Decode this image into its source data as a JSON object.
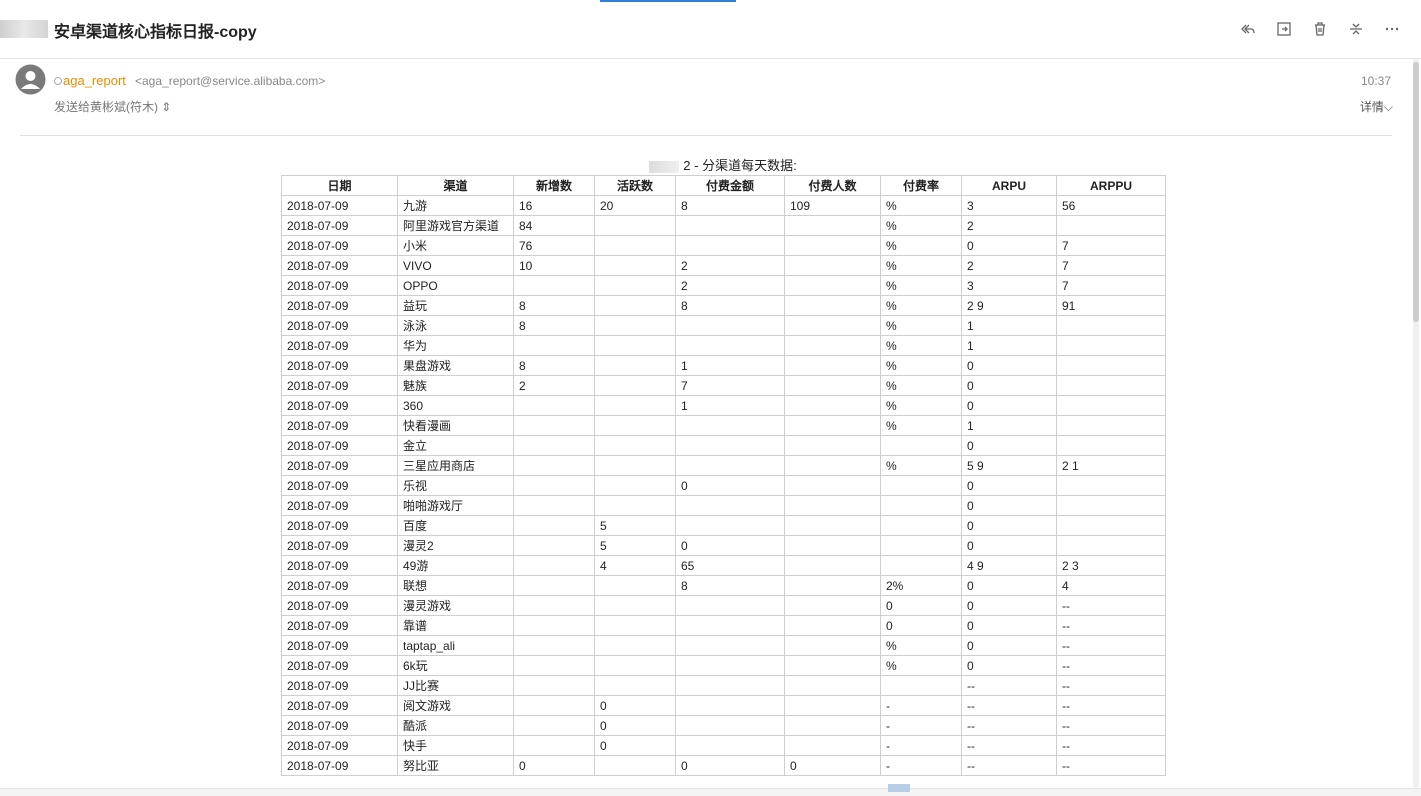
{
  "subject": "安卓渠道核心指标日报-copy",
  "toolbar": {
    "reply_all": "reply-all",
    "forward": "forward",
    "delete": "delete",
    "fold": "collapse",
    "more": "more"
  },
  "sender": {
    "name": "aga_report",
    "email": "<aga_report@service.alibaba.com>",
    "recipients": "发送给黄彬斌(符木)",
    "time": "10:37",
    "details": "详情"
  },
  "report": {
    "title": "2 - 分渠道每天数据:",
    "headers": [
      "日期",
      "渠道",
      "新增数",
      "活跃数",
      "付费金额",
      "付费人数",
      "付费率",
      "ARPU",
      "ARPPU"
    ],
    "rows": [
      [
        "2018-07-09",
        "九游",
        "16",
        "20",
        "8",
        "109",
        "%",
        "3",
        "56"
      ],
      [
        "2018-07-09",
        "阿里游戏官方渠道",
        "84",
        "",
        "",
        "",
        "%",
        "2",
        ""
      ],
      [
        "2018-07-09",
        "小米",
        "76",
        "",
        "",
        "",
        "%",
        "0",
        "7"
      ],
      [
        "2018-07-09",
        "VIVO",
        "10",
        "",
        "2",
        "",
        "%",
        "2",
        "7"
      ],
      [
        "2018-07-09",
        "OPPO",
        "",
        "",
        "2",
        "",
        "%",
        "3",
        "7"
      ],
      [
        "2018-07-09",
        "益玩",
        "8",
        "",
        "8",
        "",
        "%",
        "2 9",
        "91"
      ],
      [
        "2018-07-09",
        "泳泳",
        "8",
        "",
        "",
        "",
        "%",
        "1",
        ""
      ],
      [
        "2018-07-09",
        "华为",
        "",
        "",
        "",
        "",
        "%",
        "1",
        ""
      ],
      [
        "2018-07-09",
        "果盘游戏",
        "8",
        "",
        "1",
        "",
        "%",
        "0",
        ""
      ],
      [
        "2018-07-09",
        "魅族",
        "2",
        "",
        "7",
        "",
        "%",
        "0",
        ""
      ],
      [
        "2018-07-09",
        "360",
        "",
        "",
        "1",
        "",
        "%",
        "0",
        ""
      ],
      [
        "2018-07-09",
        "快看漫画",
        "",
        "",
        "",
        "",
        "%",
        "1",
        ""
      ],
      [
        "2018-07-09",
        "金立",
        "",
        "",
        "",
        "",
        "",
        "0",
        ""
      ],
      [
        "2018-07-09",
        "三星应用商店",
        "",
        "",
        "",
        "",
        "%",
        "5 9",
        "2 1"
      ],
      [
        "2018-07-09",
        "乐视",
        "",
        "",
        "0",
        "",
        "",
        "0",
        ""
      ],
      [
        "2018-07-09",
        "啪啪游戏厅",
        "",
        "",
        "",
        "",
        "",
        "0",
        ""
      ],
      [
        "2018-07-09",
        "百度",
        "",
        "5",
        "",
        "",
        "",
        "0",
        ""
      ],
      [
        "2018-07-09",
        "漫灵2",
        "",
        "5",
        "0",
        "",
        "",
        "0",
        ""
      ],
      [
        "2018-07-09",
        "49游",
        "",
        "4",
        "65",
        "",
        "",
        "4 9",
        "2 3"
      ],
      [
        "2018-07-09",
        "联想",
        "",
        "",
        "8",
        "",
        "2%",
        "0",
        "4"
      ],
      [
        "2018-07-09",
        "漫灵游戏",
        "",
        "",
        "",
        "",
        "0",
        "0",
        "--"
      ],
      [
        "2018-07-09",
        "靠谱",
        "",
        "",
        "",
        "",
        "0",
        "0",
        "--"
      ],
      [
        "2018-07-09",
        "taptap_ali",
        "",
        "",
        "",
        "",
        "%",
        "0",
        "--"
      ],
      [
        "2018-07-09",
        "6k玩",
        "",
        "",
        "",
        "",
        "%",
        "0",
        "--"
      ],
      [
        "2018-07-09",
        "JJ比赛",
        "",
        "",
        "",
        "",
        "",
        "--",
        "--"
      ],
      [
        "2018-07-09",
        "阅文游戏",
        "",
        "0",
        "",
        "",
        "-",
        "--",
        "--"
      ],
      [
        "2018-07-09",
        "酷派",
        "",
        "0",
        "",
        "",
        "-",
        "--",
        "--"
      ],
      [
        "2018-07-09",
        "快手",
        "",
        "0",
        "",
        "",
        "-",
        "--",
        "--"
      ],
      [
        "2018-07-09",
        "努比亚",
        "0",
        "",
        "0",
        "0",
        "-",
        "--",
        "--"
      ]
    ]
  }
}
